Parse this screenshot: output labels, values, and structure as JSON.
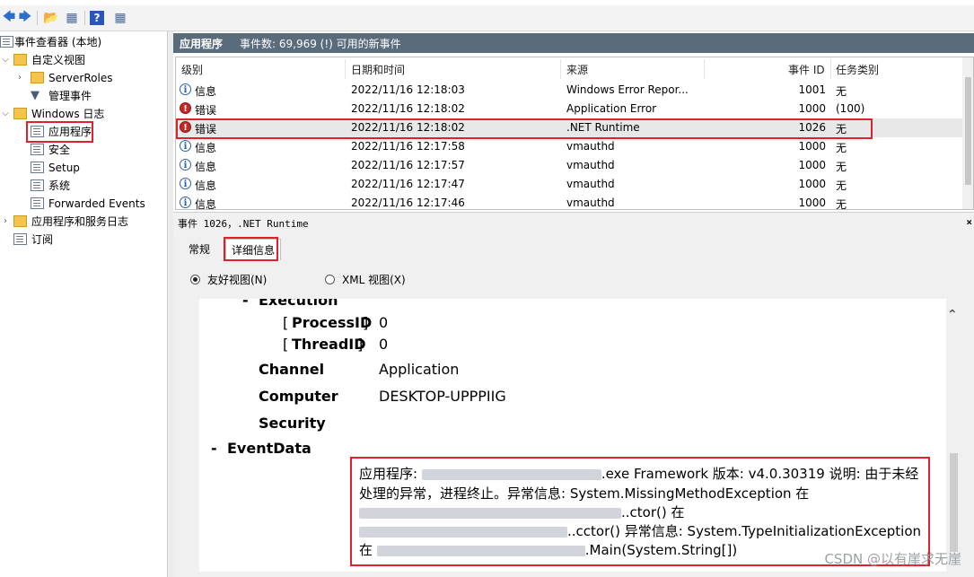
{
  "tree": {
    "root_label": "事件查看器 (本地)",
    "custom_views": "自定义视图",
    "server_roles": "ServerRoles",
    "admin_events": "管理事件",
    "windows_logs": "Windows 日志",
    "application": "应用程序",
    "security": "安全",
    "setup": "Setup",
    "system": "系统",
    "forwarded": "Forwarded Events",
    "app_service_logs": "应用程序和服务日志",
    "subscriptions": "订阅"
  },
  "header": {
    "title": "应用程序",
    "count": "事件数: 69,969 (!) 可用的新事件"
  },
  "columns": [
    "级别",
    "日期和时间",
    "来源",
    "事件 ID",
    "任务类别"
  ],
  "events": [
    {
      "level": "信息",
      "type": "info",
      "datetime": "2022/11/16 12:18:03",
      "source": "Windows Error Repor...",
      "id": "1001",
      "task": "无"
    },
    {
      "level": "错误",
      "type": "error",
      "datetime": "2022/11/16 12:18:02",
      "source": "Application Error",
      "id": "1000",
      "task": "(100)"
    },
    {
      "level": "错误",
      "type": "error",
      "datetime": "2022/11/16 12:18:02",
      "source": ".NET Runtime",
      "id": "1026",
      "task": "无"
    },
    {
      "level": "信息",
      "type": "info",
      "datetime": "2022/11/16 12:17:58",
      "source": "vmauthd",
      "id": "1000",
      "task": "无"
    },
    {
      "level": "信息",
      "type": "info",
      "datetime": "2022/11/16 12:17:57",
      "source": "vmauthd",
      "id": "1000",
      "task": "无"
    },
    {
      "level": "信息",
      "type": "info",
      "datetime": "2022/11/16 12:17:47",
      "source": "vmauthd",
      "id": "1000",
      "task": "无"
    },
    {
      "level": "信息",
      "type": "info",
      "datetime": "2022/11/16 12:17:46",
      "source": "vmauthd",
      "id": "1000",
      "task": "无"
    }
  ],
  "detail": {
    "title": "事件 1026，.NET Runtime",
    "close": "×",
    "tab_general": "常规",
    "tab_details": "详细信息",
    "radio_friendly": "友好视图(N)",
    "radio_xml": "XML 视图(X)"
  },
  "xml": {
    "execution": "Execution",
    "process_id_key": "ProcessID",
    "process_id_val": "0",
    "thread_id_key": "ThreadID",
    "thread_id_val": "0",
    "channel_key": "Channel",
    "channel_val": "Application",
    "computer_key": "Computer",
    "computer_val": "DESKTOP-UPPPIIG",
    "security_key": "Security",
    "eventdata_key": "EventData",
    "collapse": "-",
    "bracket_open": "[",
    "bracket_close": "]"
  },
  "eventdata": {
    "line1_a": "应用程序: ",
    "line1_b": ".exe Framework 版本: v4.0.30319 说明: 由于未经",
    "line2": "处理的异常，进程终止。异常信息: System.MissingMethodException 在",
    "line3": "..ctor() 在",
    "line4": "..cctor() 异常信息: System.TypeInitializationException",
    "line5_a": "在 ",
    "line5_b": ".Main(System.String[])"
  },
  "watermark": "CSDN @以有崖求无崖",
  "colors": {
    "accent_red": "#e0202a",
    "header_bg": "#5a6b7c"
  }
}
